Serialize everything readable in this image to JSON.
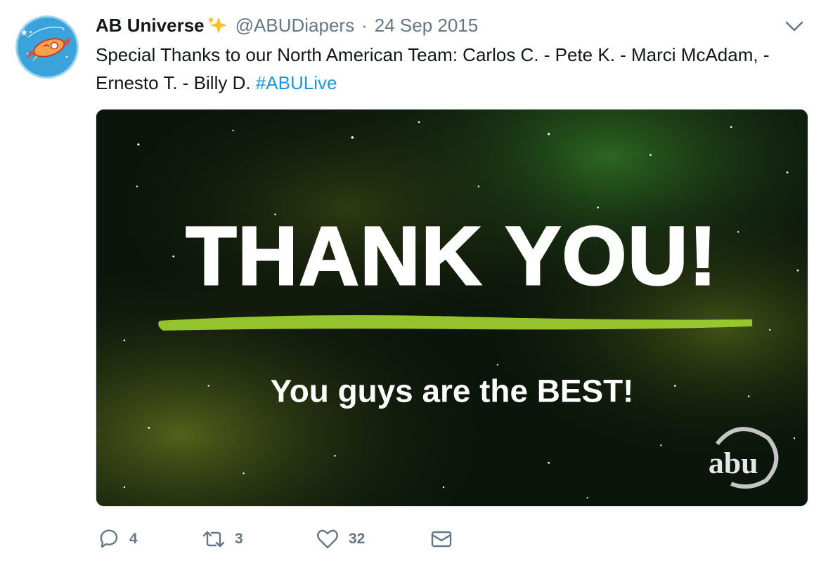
{
  "tweet": {
    "display_name": "AB Universe",
    "name_emoji": "sparkles-emoji",
    "handle": "@ABUDiapers",
    "separator": "·",
    "date": "24 Sep 2015",
    "text": "Special Thanks to our North American Team: Carlos C. - Pete K. - Marci McAdam, - Ernesto T. - Billy D.",
    "hashtag": "#ABULive"
  },
  "media": {
    "headline": "THANK YOU!",
    "subline": "You guys are the BEST!",
    "logo_text": "abu",
    "accent_color": "#9ccc2f"
  },
  "actions": {
    "reply_count": "4",
    "retweet_count": "3",
    "like_count": "32"
  },
  "icons": {
    "reply": "reply-icon",
    "retweet": "retweet-icon",
    "like": "heart-icon",
    "message": "envelope-icon",
    "menu": "chevron-down-icon"
  },
  "colors": {
    "link": "#1b95e0",
    "muted": "#657786",
    "text": "#14171a"
  }
}
